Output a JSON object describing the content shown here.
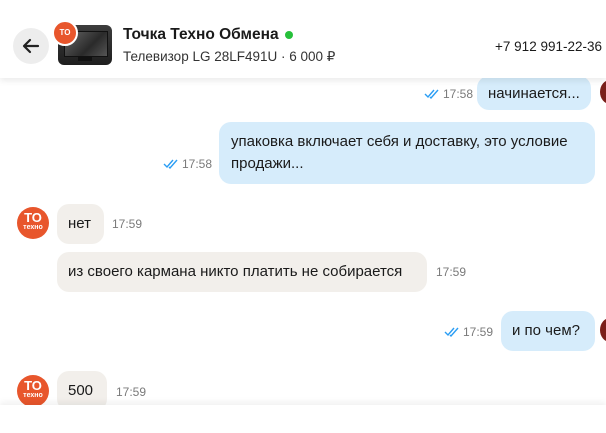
{
  "header": {
    "title": "Точка Техно Обмена",
    "subtitle": "Телевизор LG 28LF491U · 6 000 ₽",
    "phone": "+7 912 991-22-36",
    "online_color": "#26c03a"
  },
  "avatar": {
    "line1": "ТО",
    "line2": "техно"
  },
  "messages": [
    {
      "dir": "out",
      "text": "начинается...",
      "time": "17:58",
      "status": "read"
    },
    {
      "dir": "out",
      "text": "упаковка включает себя и доставку, это условие продажи...",
      "time": "17:58",
      "status": "read"
    },
    {
      "dir": "in",
      "text": "нет",
      "time": "17:59"
    },
    {
      "dir": "in",
      "text": "из своего кармана никто платить не собирается",
      "time": "17:59"
    },
    {
      "dir": "out",
      "text": "и по чем?",
      "time": "17:59",
      "status": "read"
    },
    {
      "dir": "in",
      "text": "500",
      "time": "17:59"
    }
  ],
  "colors": {
    "outgoing": "#d6ecfb",
    "incoming": "#f2efeb",
    "tick": "#2a9df4",
    "brand": "#e8562c"
  }
}
